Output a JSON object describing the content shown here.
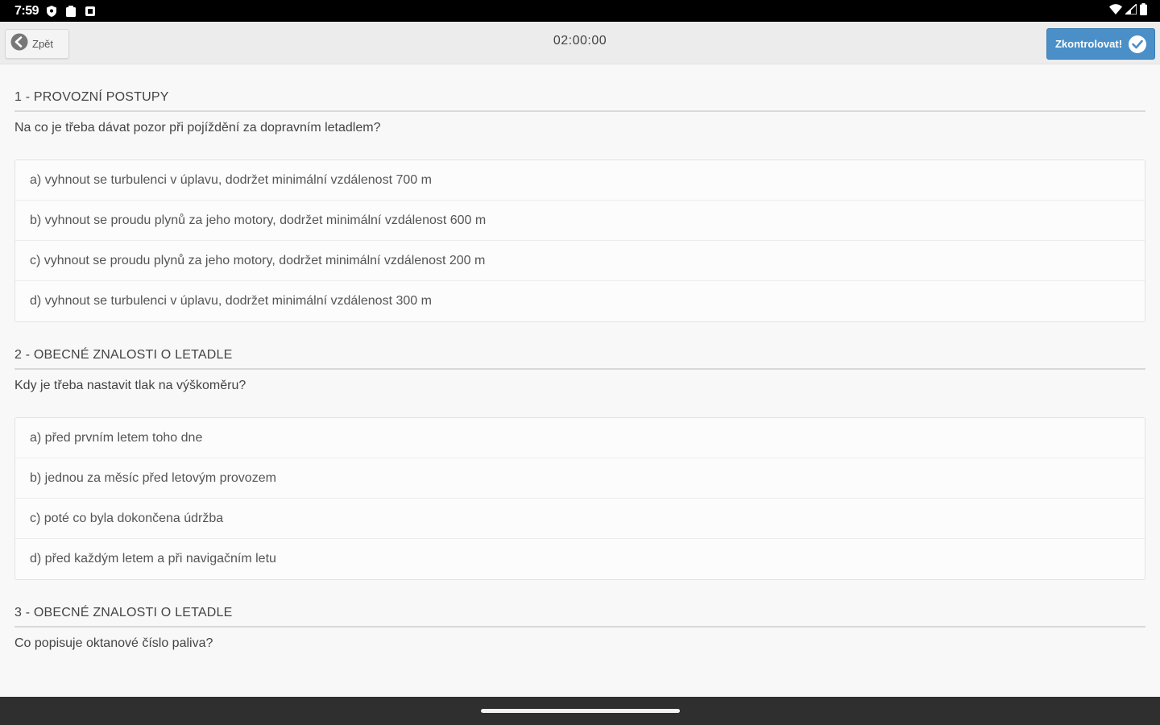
{
  "status_bar": {
    "time": "7:59",
    "icons_left": [
      "shield-icon",
      "clipboard-icon",
      "square-icon"
    ],
    "icons_right": [
      "wifi-icon",
      "signal-icon",
      "battery-icon"
    ]
  },
  "toolbar": {
    "back_label": "Zpět",
    "timer": "02:00:00",
    "check_label": "Zkontrolovat!",
    "accent_color": "#4a8fc8"
  },
  "questions": [
    {
      "heading": "1 - PROVOZNÍ POSTUPY",
      "text": "Na co je třeba dávat pozor při pojíždění za dopravním letadlem?",
      "answers": [
        "a) vyhnout se turbulenci v úplavu, dodržet minimální vzdálenost 700 m",
        "b) vyhnout se proudu plynů za jeho motory, dodržet minimální vzdálenost 600 m",
        "c) vyhnout se proudu plynů za jeho motory, dodržet minimální vzdálenost 200 m",
        "d) vyhnout se turbulenci v úplavu, dodržet minimální vzdálenost 300 m"
      ]
    },
    {
      "heading": "2 - OBECNÉ ZNALOSTI O LETADLE",
      "text": "Kdy je třeba nastavit tlak na výškoměru?",
      "answers": [
        "a) před prvním letem toho dne",
        "b) jednou za měsíc před letovým provozem",
        "c) poté co byla dokončena údržba",
        "d) před každým letem a při navigačním letu"
      ]
    },
    {
      "heading": "3 - OBECNÉ ZNALOSTI O LETADLE",
      "text": "Co popisuje oktanové číslo paliva?"
    }
  ]
}
